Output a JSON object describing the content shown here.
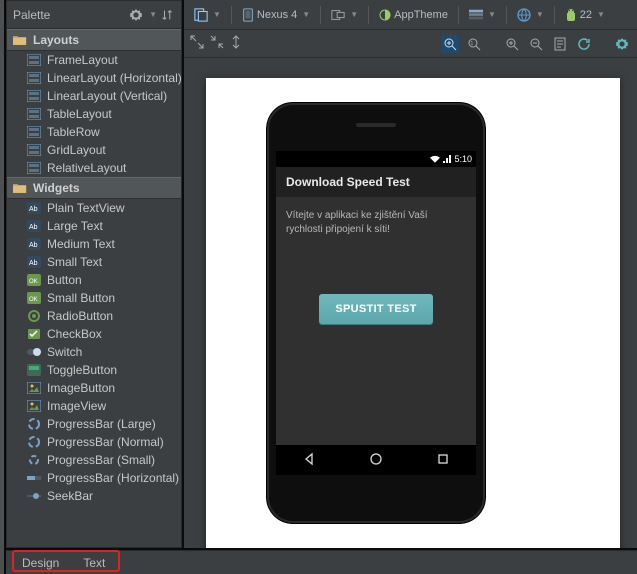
{
  "palette": {
    "title": "Palette",
    "groups": [
      {
        "label": "Layouts"
      },
      {
        "label": "Widgets"
      }
    ],
    "layouts": [
      "FrameLayout",
      "LinearLayout (Horizontal)",
      "LinearLayout (Vertical)",
      "TableLayout",
      "TableRow",
      "GridLayout",
      "RelativeLayout"
    ],
    "widgets": [
      "Plain TextView",
      "Large Text",
      "Medium Text",
      "Small Text",
      "Button",
      "Small Button",
      "RadioButton",
      "CheckBox",
      "Switch",
      "ToggleButton",
      "ImageButton",
      "ImageView",
      "ProgressBar (Large)",
      "ProgressBar (Normal)",
      "ProgressBar (Small)",
      "ProgressBar (Horizontal)",
      "SeekBar"
    ]
  },
  "toolbar": {
    "device": "Nexus 4",
    "theme": "AppTheme",
    "api": "22"
  },
  "phone": {
    "time": "5:10",
    "app_title": "Download Speed Test",
    "welcome": "Vítejte v aplikaci ke zjištění Vaší rychlosti připojení k síti!",
    "button": "SPUSTIT TEST"
  },
  "bottom": {
    "design": "Design",
    "text": "Text"
  }
}
